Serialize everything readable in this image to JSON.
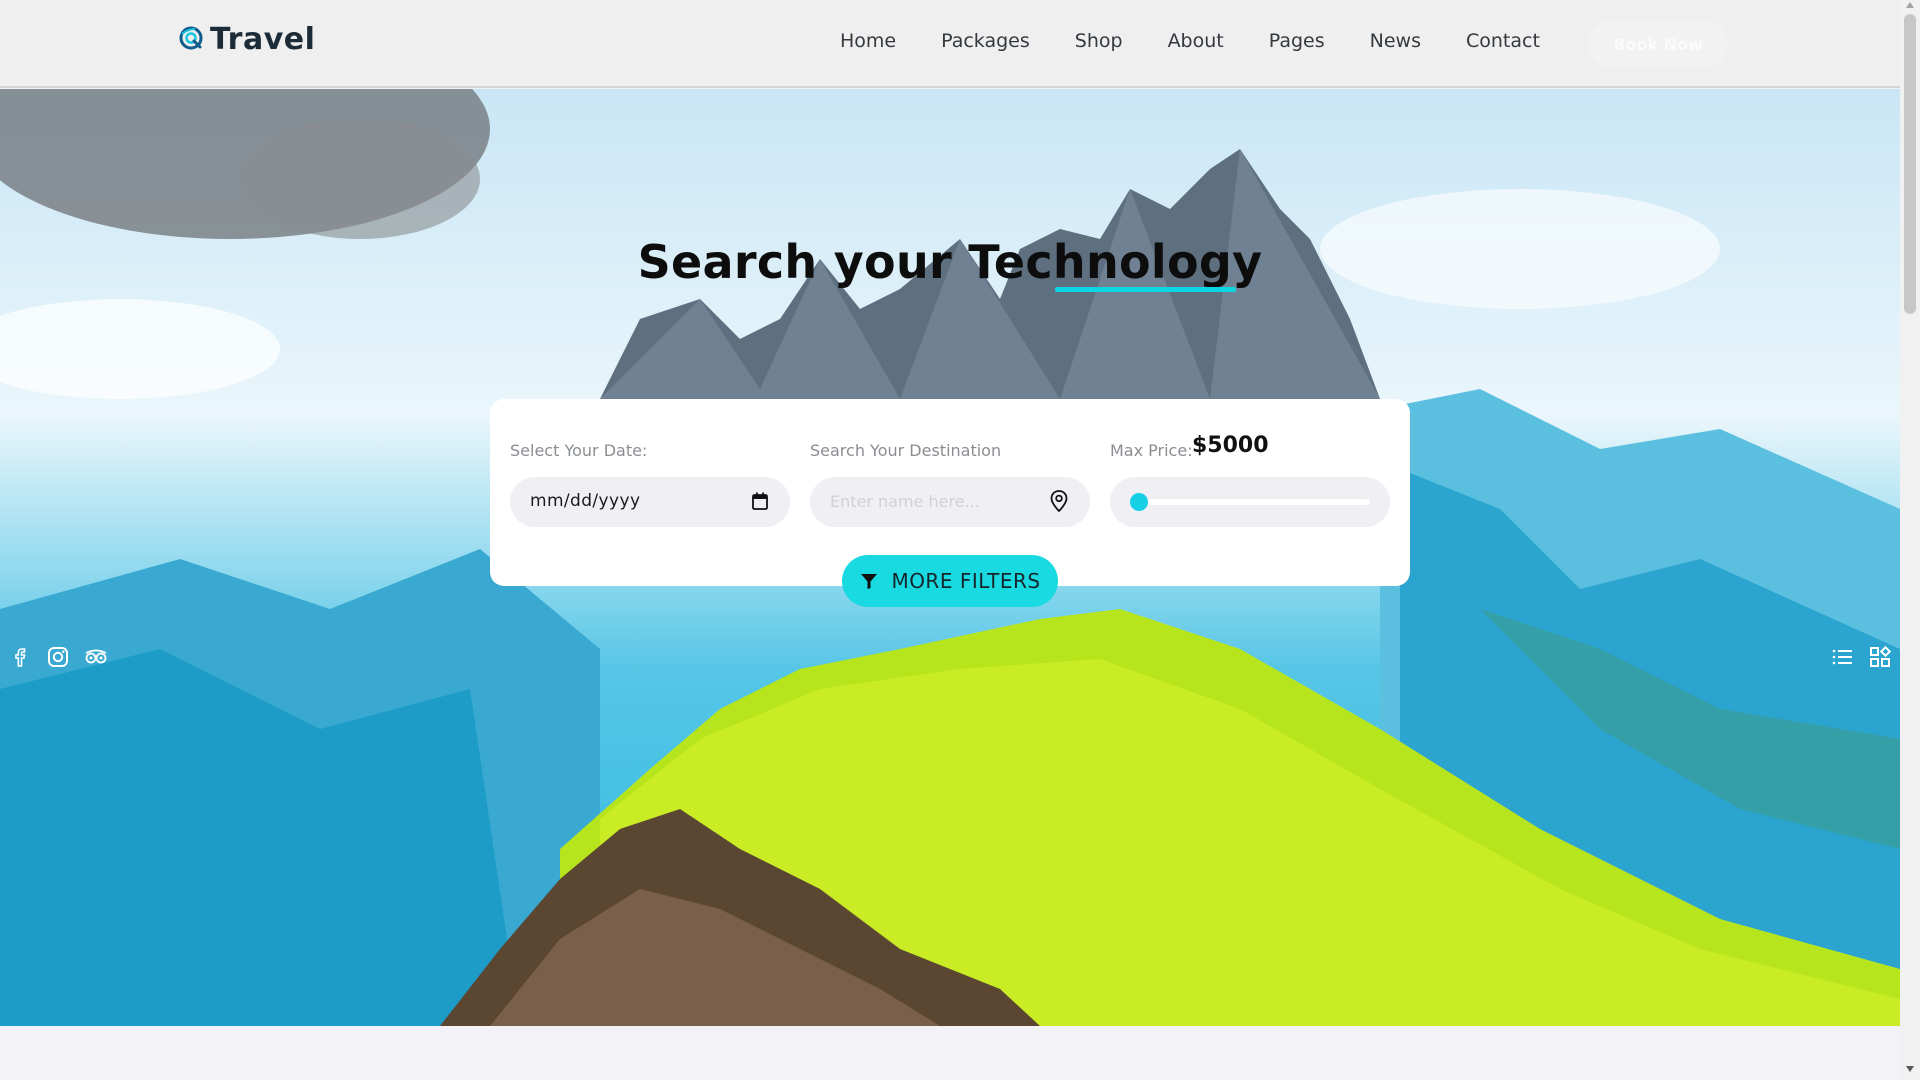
{
  "header": {
    "logo_text": "Travel",
    "nav": [
      "Home",
      "Packages",
      "Shop",
      "About",
      "Pages",
      "News",
      "Contact"
    ],
    "book_label": "Book Now"
  },
  "hero": {
    "title": "Search your Technology",
    "accent_color": "#17d3e3"
  },
  "search": {
    "date_label": "Select Your Date:",
    "date_value": "mm/dd/yyyy",
    "destination_label": "Search Your Destination",
    "destination_placeholder": "Enter name here...",
    "price_label": "Max Price:",
    "price_value": "$5000",
    "price_slider_level": 0,
    "filters_label": "MORE FILTERS"
  },
  "social_icons": [
    "facebook-icon",
    "instagram-icon",
    "tripadvisor-icon"
  ],
  "view_icons": [
    "list-view-icon",
    "grid-view-icon"
  ]
}
